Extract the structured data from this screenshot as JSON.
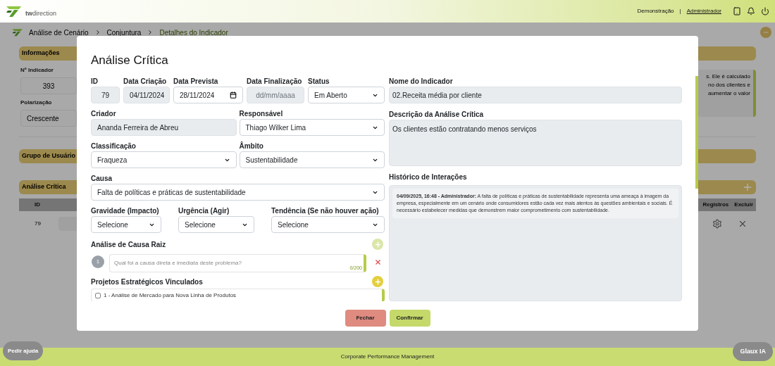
{
  "header": {
    "logo_text": "**tw**direction",
    "links": [
      {
        "label": "Demonstração",
        "underlined": false
      },
      {
        "label": "Administrador",
        "underlined": true
      }
    ],
    "separator": "|"
  },
  "breadcrumb": [
    "Análise de Cenário",
    "Conjuntura",
    "Detalhes do Indicador"
  ],
  "info_panel": {
    "title": "Informações",
    "fields": [
      {
        "label": "Nº Indicador",
        "value": "393"
      },
      {
        "label": "Polarização",
        "value": "Crescente"
      }
    ],
    "description_lines": [
      "s. Ele é calculado",
      "no dos clientes e",
      "aumentar o valor"
    ]
  },
  "user_group": {
    "title": "Grupo de Usuário"
  },
  "critical_panel": {
    "title": "Análise Crítica",
    "columns": [
      "ID",
      "Registros",
      "Excluir"
    ],
    "rows": [
      {
        "id": "79"
      }
    ]
  },
  "modal": {
    "title": "Análise Crítica",
    "left_rows": [
      [
        {
          "label": "ID",
          "value": "79",
          "kind": "text",
          "readonly": true
        },
        {
          "label": "Data Criação",
          "value": "04/11/2024",
          "kind": "text",
          "readonly": true
        },
        {
          "label": "Data Prevista",
          "value": "28/11/2024",
          "kind": "date",
          "readonly": false
        },
        {
          "label": "Data Finalização",
          "placeholder": "dd/mm/aaaa",
          "kind": "text",
          "readonly": true
        },
        {
          "label": "Status",
          "value": "Em Aberto",
          "kind": "select",
          "readonly": false
        }
      ],
      [
        {
          "label": "Criador",
          "value": "Ananda Ferreira de Abreu",
          "kind": "text",
          "readonly": true
        },
        {
          "label": "Responsável",
          "value": "Thiago Wilker Lima",
          "kind": "select",
          "readonly": false
        }
      ],
      [
        {
          "label": "Classificação",
          "value": "Fraqueza",
          "kind": "select",
          "readonly": false
        },
        {
          "label": "Âmbito",
          "value": "Sustentabilidade",
          "kind": "select",
          "readonly": false
        }
      ],
      [
        {
          "label": "Causa",
          "value": "Falta de políticas e práticas de sustentabilidade",
          "kind": "select",
          "readonly": false
        }
      ],
      [
        {
          "label": "Gravidade (Impacto)",
          "value": "Selecione",
          "kind": "select",
          "readonly": false
        },
        {
          "label": "Urgência (Agir)",
          "value": "Selecione",
          "kind": "select",
          "readonly": false
        },
        {
          "label": "Tendência (Se não houver ação)",
          "value": "Selecione",
          "kind": "select",
          "readonly": false
        }
      ]
    ],
    "root_cause": {
      "title": "Análise de Causa Raiz",
      "add_enabled": false,
      "items": [
        {
          "number": "1",
          "placeholder": "Qual foi a causa direta e imediata deste problema?",
          "counter": "0/200"
        }
      ]
    },
    "projects": {
      "title": "Projetos Estratégicos Vinculados",
      "add_enabled": true,
      "items": [
        {
          "label": "1 - Análise de Mercado para Nova Linha de Produtos",
          "checked": false
        }
      ]
    },
    "indicator_name": {
      "label": "Nome do Indicador",
      "value": "02.Receita média por cliente"
    },
    "description": {
      "label": "Descrição da Análise Crítica",
      "value": "Os clientes estão contratando menos serviços"
    },
    "history": {
      "label": "Histórico de Interações",
      "entries": [
        "**04/09/2025, 16:48 - Administrador:**  A falta de políticas e práticas de sustentabilidade representa uma ameaça à imagem da empresa, especialmente em um cenário onde consumidores estão cada vez mais atentos às questões ambientais e sociais. É necessário estabelecer medidas que demonstrem maior comprometimento com sustentabilidade."
      ]
    },
    "buttons": [
      {
        "label": "Fechar",
        "kind": "cancel"
      },
      {
        "label": "Confirmar",
        "kind": "confirm"
      }
    ]
  },
  "footer": "Corporate Performance Management",
  "help_button": "Pedir ajuda",
  "ai_button": "Glaux IA"
}
